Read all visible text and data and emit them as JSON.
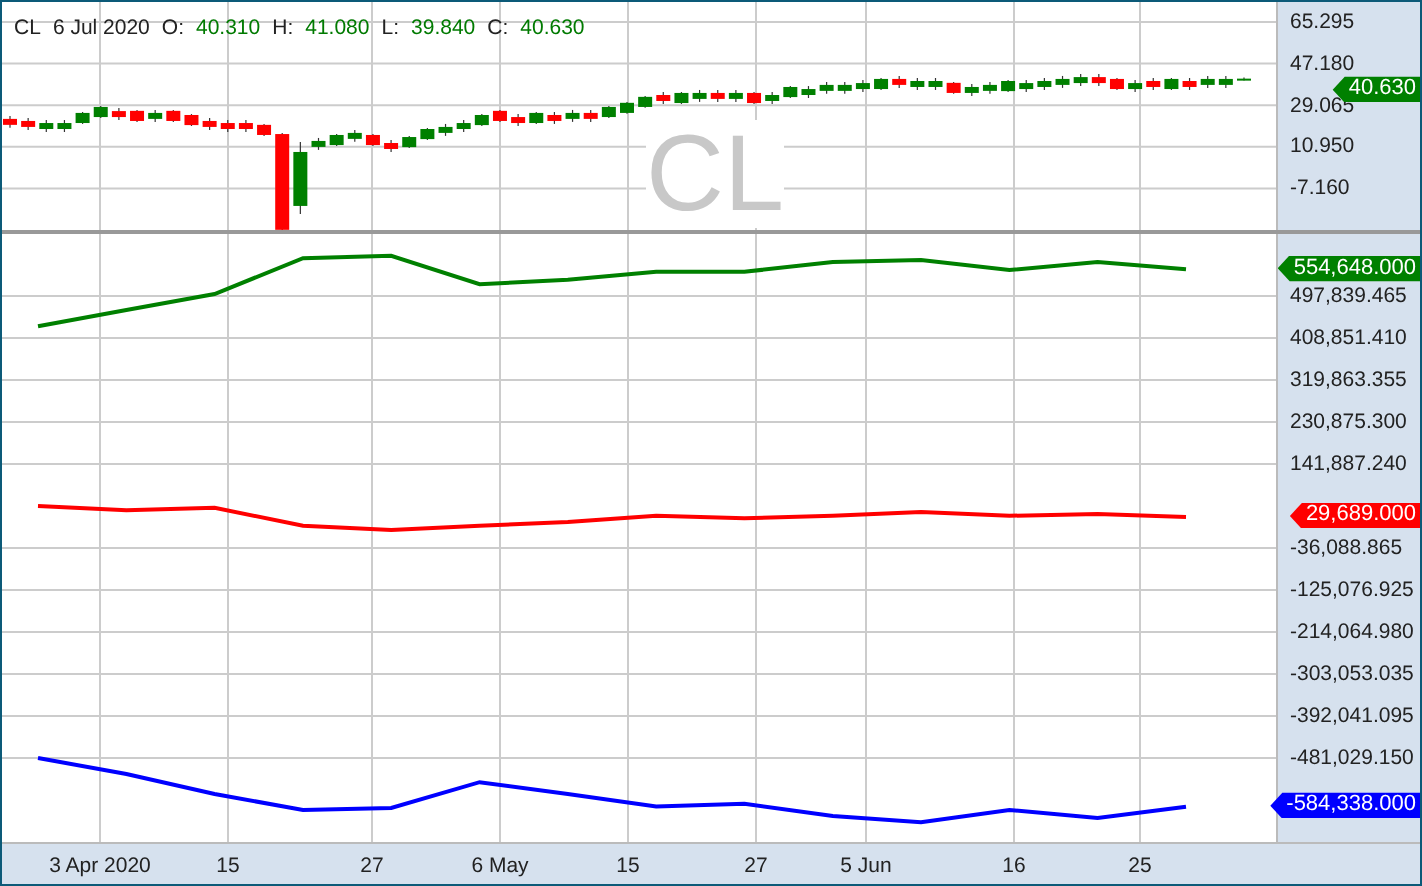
{
  "header": {
    "symbol": "CL",
    "date": "6 Jul 2020",
    "fields": [
      {
        "label": "O:",
        "value": "40.310"
      },
      {
        "label": "H:",
        "value": "41.080"
      },
      {
        "label": "L:",
        "value": "39.840"
      },
      {
        "label": "C:",
        "value": "40.630"
      }
    ]
  },
  "price_panel": {
    "watermark_symbol": "CL",
    "chart_data": {
      "type": "candlestick",
      "grid": true,
      "categories": [
        null,
        null,
        null,
        null,
        null,
        null,
        null,
        null,
        null,
        null,
        null,
        null,
        null,
        null,
        null,
        null,
        null,
        null,
        null,
        null,
        null,
        null,
        null,
        null,
        null,
        null,
        null,
        null,
        null,
        null,
        null,
        null,
        null,
        null,
        null,
        null,
        null,
        null,
        null,
        null,
        null,
        null,
        null,
        null,
        null,
        null,
        null,
        null,
        null,
        null,
        null,
        null,
        null,
        null,
        null,
        null,
        null,
        null,
        null,
        null,
        null,
        null,
        null,
        null,
        null,
        null,
        null,
        null,
        null
      ],
      "ylim": [
        -25.28,
        74.0
      ],
      "yticks": [
        {
          "value": 65.295,
          "label": "65.295"
        },
        {
          "value": 47.18,
          "label": "47.180"
        },
        {
          "value": 29.065,
          "label": "29.065"
        },
        {
          "value": 10.95,
          "label": "10.950"
        },
        {
          "value": -7.16,
          "label": "-7.160"
        }
      ],
      "ohlc": [
        [
          23.1,
          24.4,
          19.2,
          20.5
        ],
        [
          22.2,
          23.5,
          18.3,
          19.6
        ],
        [
          18.7,
          22.6,
          17.4,
          21.3
        ],
        [
          18.7,
          22.6,
          17.4,
          21.3
        ],
        [
          21.3,
          26.1,
          20.9,
          25.7
        ],
        [
          23.9,
          28.7,
          23.5,
          28.3
        ],
        [
          26.5,
          27.8,
          22.6,
          23.9
        ],
        [
          26.6,
          27.0,
          21.8,
          22.2
        ],
        [
          23.1,
          27.0,
          21.8,
          25.7
        ],
        [
          26.6,
          27.0,
          21.8,
          22.2
        ],
        [
          24.8,
          25.2,
          20.0,
          20.4
        ],
        [
          22.2,
          23.5,
          18.3,
          19.6
        ],
        [
          21.3,
          22.6,
          17.4,
          18.7
        ],
        [
          21.3,
          22.6,
          17.4,
          18.7
        ],
        [
          20.5,
          20.9,
          15.7,
          16.1
        ],
        [
          16.5,
          17.0,
          -25.3,
          -25.2
        ],
        [
          -14.8,
          13.0,
          -18.3,
          8.7
        ],
        [
          10.9,
          14.8,
          9.6,
          13.5
        ],
        [
          11.7,
          16.5,
          11.3,
          16.1
        ],
        [
          14.4,
          18.3,
          13.1,
          17.0
        ],
        [
          16.1,
          16.5,
          11.3,
          11.7
        ],
        [
          12.6,
          13.9,
          8.7,
          10.0
        ],
        [
          10.8,
          15.6,
          10.4,
          15.2
        ],
        [
          14.3,
          19.1,
          13.9,
          18.7
        ],
        [
          17.0,
          20.9,
          15.7,
          19.6
        ],
        [
          18.7,
          22.6,
          17.4,
          21.3
        ],
        [
          20.4,
          25.2,
          20.0,
          24.8
        ],
        [
          26.6,
          27.0,
          21.8,
          22.2
        ],
        [
          23.9,
          25.2,
          20.0,
          21.3
        ],
        [
          21.3,
          26.1,
          20.9,
          25.7
        ],
        [
          24.8,
          26.1,
          20.9,
          22.2
        ],
        [
          23.1,
          27.0,
          21.8,
          25.7
        ],
        [
          25.7,
          27.0,
          21.8,
          23.1
        ],
        [
          23.9,
          28.7,
          23.5,
          28.3
        ],
        [
          25.7,
          30.5,
          25.3,
          30.1
        ],
        [
          28.3,
          33.1,
          27.9,
          32.7
        ],
        [
          33.5,
          34.8,
          29.6,
          30.9
        ],
        [
          30.0,
          34.8,
          29.6,
          34.4
        ],
        [
          31.8,
          35.7,
          30.5,
          34.4
        ],
        [
          34.4,
          35.7,
          30.5,
          31.8
        ],
        [
          31.8,
          35.7,
          30.5,
          34.4
        ],
        [
          34.4,
          34.8,
          29.6,
          30.0
        ],
        [
          30.9,
          34.8,
          29.6,
          33.5
        ],
        [
          32.6,
          37.4,
          32.2,
          37.0
        ],
        [
          33.5,
          37.4,
          32.2,
          36.1
        ],
        [
          35.3,
          39.2,
          34.0,
          37.9
        ],
        [
          35.3,
          39.2,
          34.0,
          37.9
        ],
        [
          36.1,
          40.0,
          34.8,
          38.7
        ],
        [
          36.1,
          40.9,
          35.7,
          40.5
        ],
        [
          40.5,
          41.8,
          36.6,
          37.9
        ],
        [
          37.0,
          40.9,
          35.7,
          39.6
        ],
        [
          37.0,
          40.9,
          35.7,
          39.6
        ],
        [
          38.8,
          39.2,
          34.0,
          34.4
        ],
        [
          34.4,
          38.3,
          33.1,
          37.0
        ],
        [
          35.3,
          39.2,
          34.0,
          37.9
        ],
        [
          35.2,
          40.0,
          34.8,
          39.6
        ],
        [
          36.1,
          40.0,
          34.8,
          38.7
        ],
        [
          37.0,
          40.9,
          35.7,
          39.6
        ],
        [
          37.9,
          41.8,
          36.6,
          40.5
        ],
        [
          38.7,
          42.6,
          37.4,
          41.3
        ],
        [
          41.3,
          42.6,
          37.4,
          38.7
        ],
        [
          40.5,
          40.9,
          35.7,
          36.1
        ],
        [
          36.1,
          40.0,
          34.8,
          38.7
        ],
        [
          39.6,
          40.9,
          35.7,
          37.0
        ],
        [
          36.1,
          40.9,
          35.7,
          40.5
        ],
        [
          39.6,
          40.9,
          35.7,
          37.0
        ],
        [
          37.9,
          41.8,
          36.6,
          40.5
        ],
        [
          37.9,
          41.8,
          36.6,
          40.5
        ],
        [
          40.31,
          41.08,
          39.84,
          40.63
        ]
      ]
    },
    "last_price": {
      "label": "40.630",
      "color": "#008000"
    }
  },
  "indicator_panel": {
    "chart_data": {
      "type": "line",
      "grid": true,
      "categories": [
        null,
        null,
        null,
        null,
        null,
        null,
        null,
        null,
        null,
        null,
        null,
        null,
        null,
        null
      ],
      "ylim": [
        -658895,
        629153
      ],
      "yticks": [
        {
          "value": 497839.465,
          "label": "497,839.465"
        },
        {
          "value": 408851.41,
          "label": "408,851.410"
        },
        {
          "value": 319863.355,
          "label": "319,863.355"
        },
        {
          "value": 230875.3,
          "label": "230,875.300"
        },
        {
          "value": 141887.24,
          "label": "141,887.240"
        },
        {
          "value": -36088.865,
          "label": "-36,088.865"
        },
        {
          "value": -125076.925,
          "label": "-125,076.925"
        },
        {
          "value": -214064.98,
          "label": "-214,064.980"
        },
        {
          "value": -303053.035,
          "label": "-303,053.035"
        },
        {
          "value": -392041.095,
          "label": "-392,041.095"
        },
        {
          "value": -481029.15,
          "label": "-481,029.150"
        }
      ],
      "series": [
        {
          "color": "#008000",
          "values": [
            434000,
            468000,
            502000,
            578000,
            583000,
            523000,
            532000,
            549000,
            549000,
            570000,
            574000,
            553000,
            570000,
            554648
          ]
        },
        {
          "color": "#ff0000",
          "values": [
            53000,
            44000,
            49000,
            11000,
            2000,
            11000,
            19000,
            32000,
            27000,
            32000,
            40000,
            32000,
            36000,
            29689
          ]
        },
        {
          "color": "#0000ff",
          "values": [
            -481000,
            -515000,
            -557000,
            -591000,
            -587000,
            -532000,
            -557000,
            -584000,
            -578000,
            -604000,
            -617000,
            -591000,
            -608000,
            -584338
          ]
        }
      ]
    },
    "last_values": [
      {
        "label": "554,648.000",
        "color": "#008000"
      },
      {
        "label": "29,689.000",
        "color": "#ff0000"
      },
      {
        "label": "-584,338.000",
        "color": "#0000ff"
      }
    ]
  },
  "time_axis": [
    "3 Apr 2020",
    "15",
    "27",
    "6 May",
    "15",
    "27",
    "5 Jun",
    "16",
    "25"
  ]
}
